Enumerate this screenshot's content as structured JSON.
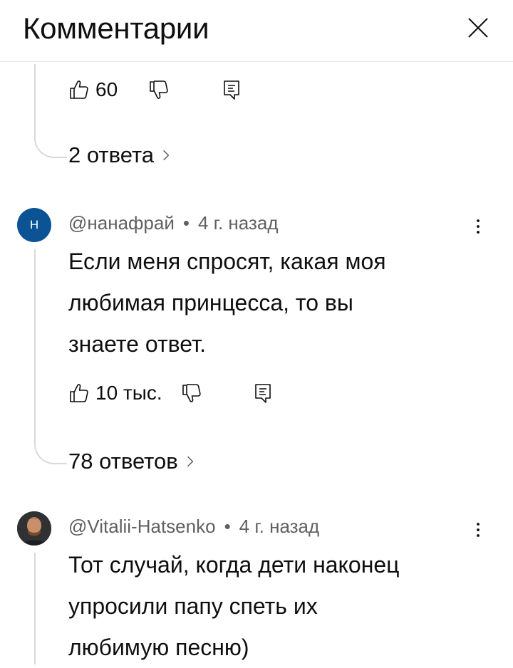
{
  "header": {
    "title": "Комментарии"
  },
  "prev_comment": {
    "likes": "60",
    "replies_label": "2 ответа"
  },
  "comments": [
    {
      "avatar_letter": "Н",
      "avatar_color": "#0b5394",
      "author": "@нанафрай",
      "separator": "•",
      "time": "4 г. назад",
      "text_lines": [
        "Если меня спросят, какая моя",
        "любимая принцесса, то вы",
        "знаете ответ."
      ],
      "likes": "10 тыс.",
      "replies_label": "78 ответов"
    },
    {
      "author": "@Vitalii-Hatsenko",
      "separator": "•",
      "time": "4 г. назад",
      "text_lines": [
        "Тот случай, когда дети наконец",
        "упросили папу спеть их",
        "любимую песню)"
      ]
    }
  ],
  "icons": {
    "like": "thumb-up-icon",
    "dislike": "thumb-down-icon",
    "reply": "reply-icon",
    "close": "close-icon",
    "more": "more-vert-icon",
    "chevron": "chevron-right-icon"
  }
}
